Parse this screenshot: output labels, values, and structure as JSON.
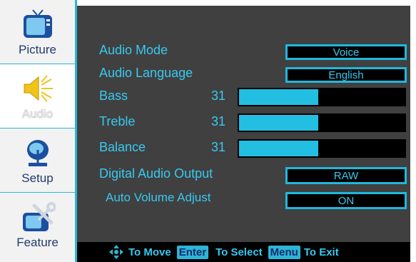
{
  "sidebar": {
    "tabs": [
      {
        "label": "Picture",
        "icon": "tv-icon"
      },
      {
        "label": "Audio",
        "icon": "speaker-icon"
      },
      {
        "label": "Setup",
        "icon": "satellite-dish-icon"
      },
      {
        "label": "Feature",
        "icon": "tv-tools-icon"
      }
    ],
    "active": "Audio"
  },
  "menu": {
    "audio_mode": {
      "label": "Audio Mode",
      "value": "Voice"
    },
    "audio_language": {
      "label": "Audio Language",
      "value": "English"
    },
    "bass": {
      "label": "Bass",
      "value": "31",
      "level": 0.48
    },
    "treble": {
      "label": "Treble",
      "value": "31",
      "level": 0.48
    },
    "balance": {
      "label": "Balance",
      "value": "31",
      "level": 0.48
    },
    "digital_audio_output": {
      "label": "Digital Audio Output",
      "value": "RAW"
    },
    "auto_volume_adjust": {
      "label": "Auto Volume Adjust",
      "value": "ON"
    }
  },
  "footer": {
    "move_text": "To Move",
    "enter_key": "Enter",
    "select_text": "To Select",
    "menu_key": "Menu",
    "exit_text": "To Exit"
  },
  "colors": {
    "accent": "#2cb5d6",
    "text": "#37c9f0",
    "panel": "#404040"
  }
}
